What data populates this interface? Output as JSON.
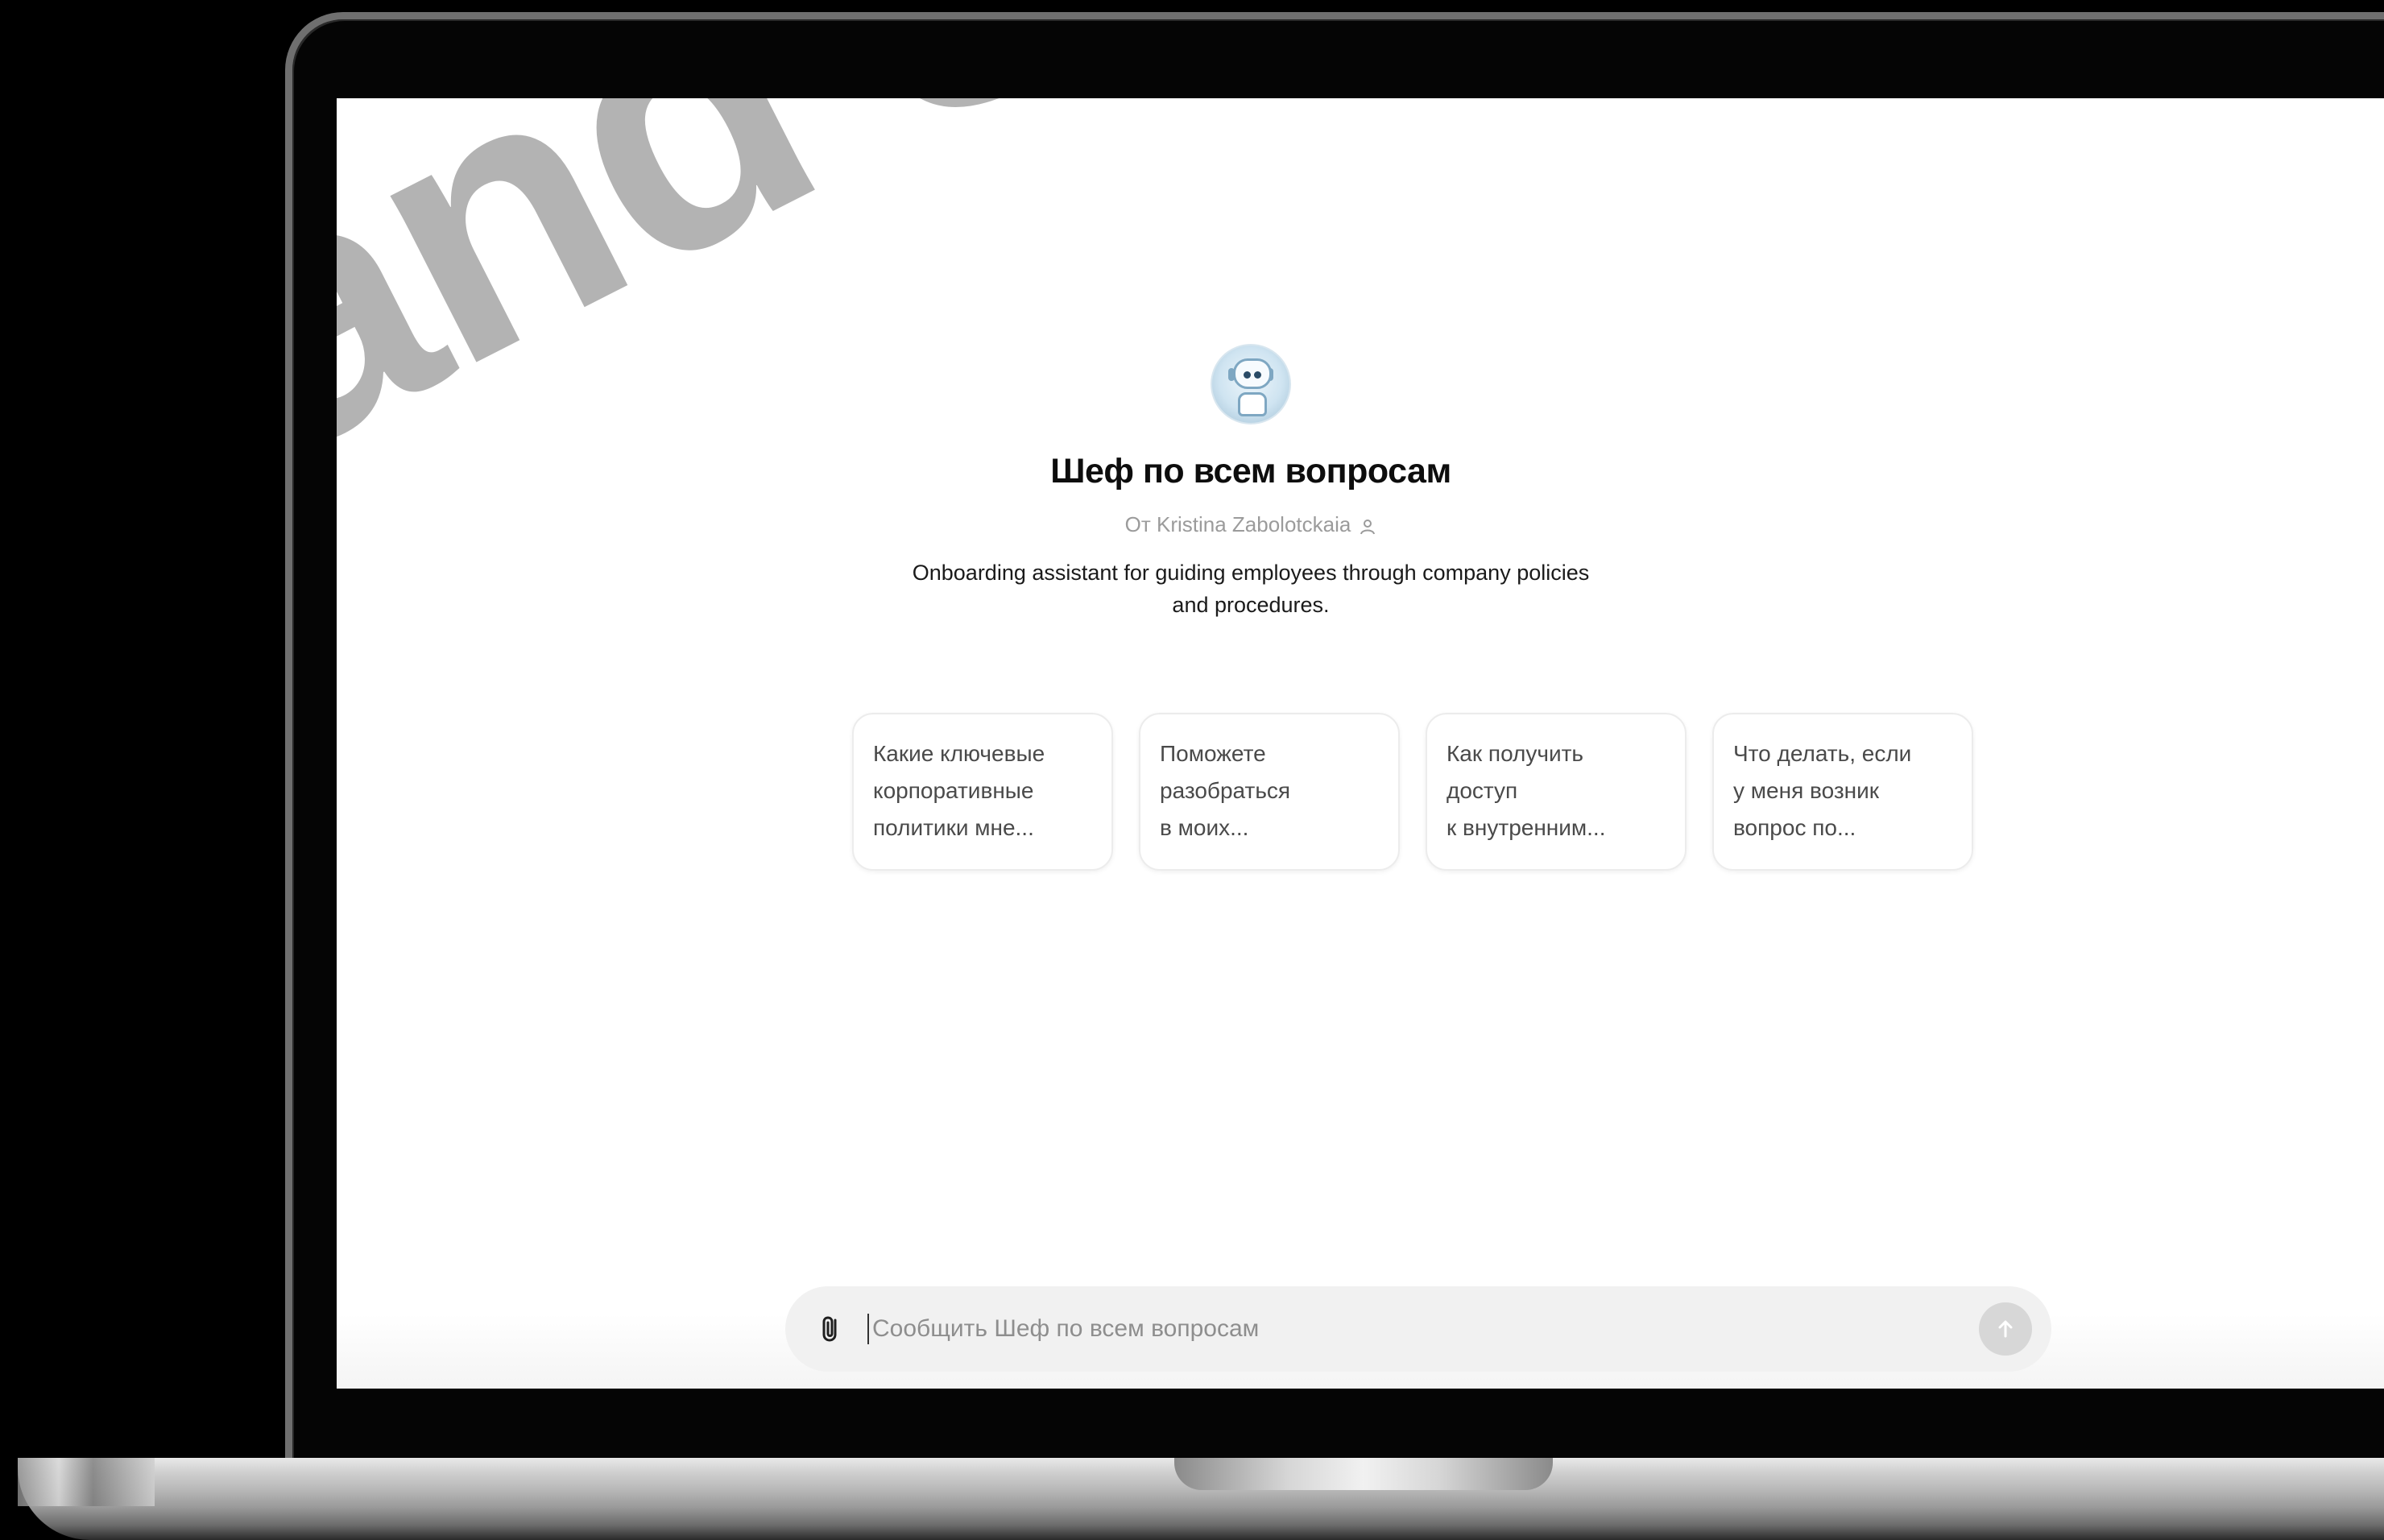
{
  "watermark": "and Sli",
  "gpt": {
    "avatar_icon": "robot-avatar",
    "title": "Шеф по всем вопросам",
    "author": "От Kristina Zabolotckaia",
    "author_icon": "person-icon",
    "description": "Onboarding assistant for guiding employees through company policies and procedures."
  },
  "starters": [
    {
      "text": "Какие ключевые\nкорпоративные\nполитики мне..."
    },
    {
      "text": "Поможете\nразобраться\nв моих..."
    },
    {
      "text": "Как получить\nдоступ\nк внутренним..."
    },
    {
      "text": "Что делать, если\nу меня возник\nвопрос по..."
    }
  ],
  "composer": {
    "placeholder": "Сообщить Шеф по всем вопросам",
    "value": "",
    "attach_icon": "paperclip-icon",
    "send_icon": "arrow-up-icon"
  }
}
